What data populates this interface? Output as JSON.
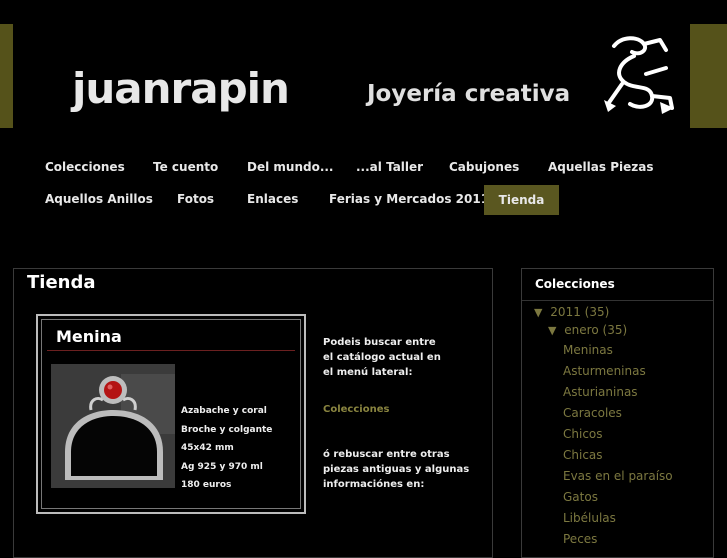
{
  "header": {
    "title": "juanrapin",
    "description": "Joyería creativa",
    "colors": {
      "bar": "#55521a"
    },
    "logo_icon": "stick-figure-logo"
  },
  "tabs": [
    {
      "label": "Colecciones"
    },
    {
      "label": "Te cuento"
    },
    {
      "label": "Del mundo..."
    },
    {
      "label": "...al Taller"
    },
    {
      "label": "Cabujones"
    },
    {
      "label": "Aquellas Piezas"
    },
    {
      "label": "Aquellos Anillos"
    },
    {
      "label": "Fotos"
    },
    {
      "label": "Enlaces"
    },
    {
      "label": "Ferias y Mercados 2011"
    },
    {
      "label": "Tienda",
      "active": true
    }
  ],
  "post": {
    "title": "Tienda",
    "product": {
      "name": "Menina",
      "specs": [
        "Azabache y coral",
        "Broche y colgante",
        "45x42 mm",
        "Ag 925 y 970 ml",
        "180 euros"
      ]
    },
    "text": {
      "line1": "Podeis buscar entre el catálogo actual en el menú lateral:",
      "link": "Colecciones",
      "line2": "ó rebuscar entre otras piezas antiguas y algunas informaciónes en:"
    }
  },
  "sidebar": {
    "title": "Colecciones",
    "year": "2011",
    "year_count": "(35)",
    "month": "enero",
    "month_count": "(35)",
    "items": [
      "Meninas",
      "Asturmeninas",
      "Asturianinas",
      "Caracoles",
      "Chicos",
      "Chicas",
      "Evas en el paraíso",
      "Gatos",
      "Libélulas",
      "Peces"
    ]
  }
}
